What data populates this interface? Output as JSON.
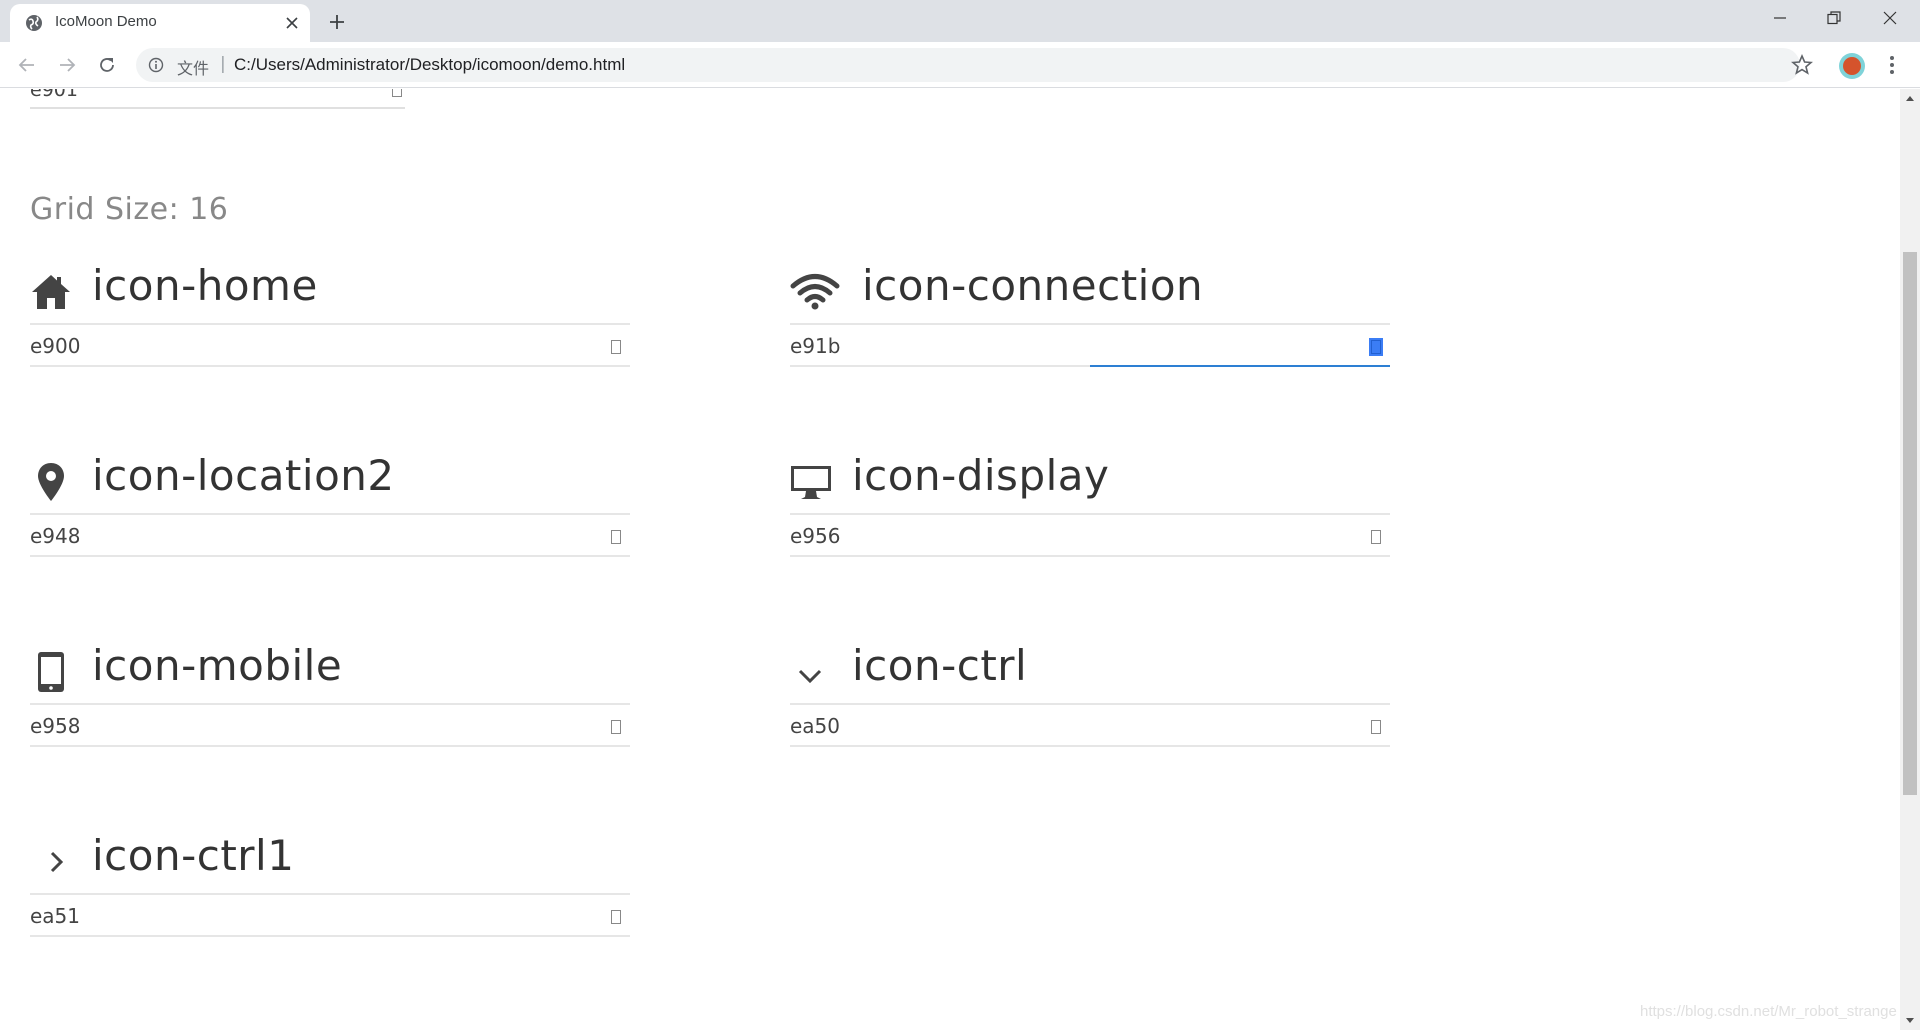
{
  "browser": {
    "tab_title": "IcoMoon Demo",
    "url_scheme_label": "文件",
    "url_separator": "|",
    "url": "C:/Users/Administrator/Desktop/icomoon/demo.html"
  },
  "page": {
    "previous_code": "e901",
    "grid_heading": "Grid Size: 16",
    "glyphs": [
      {
        "name": "icon-home",
        "code": "e900",
        "icon": "home-icon"
      },
      {
        "name": "icon-connection",
        "code": "e91b",
        "icon": "wifi-icon",
        "selected": true
      },
      {
        "name": "icon-location2",
        "code": "e948",
        "icon": "location-pin-icon"
      },
      {
        "name": "icon-display",
        "code": "e956",
        "icon": "monitor-icon"
      },
      {
        "name": "icon-mobile",
        "code": "e958",
        "icon": "mobile-phone-icon"
      },
      {
        "name": "icon-ctrl",
        "code": "ea50",
        "icon": "chevron-down-icon"
      },
      {
        "name": "icon-ctrl1",
        "code": "ea51",
        "icon": "chevron-right-icon"
      }
    ]
  },
  "watermark": "https://blog.csdn.net/Mr_robot_strange",
  "colors": {
    "chrome_bg": "#dee1e6",
    "icon": "#444444",
    "selection": "#3b7df5",
    "focus_line": "#2d7fd3"
  }
}
